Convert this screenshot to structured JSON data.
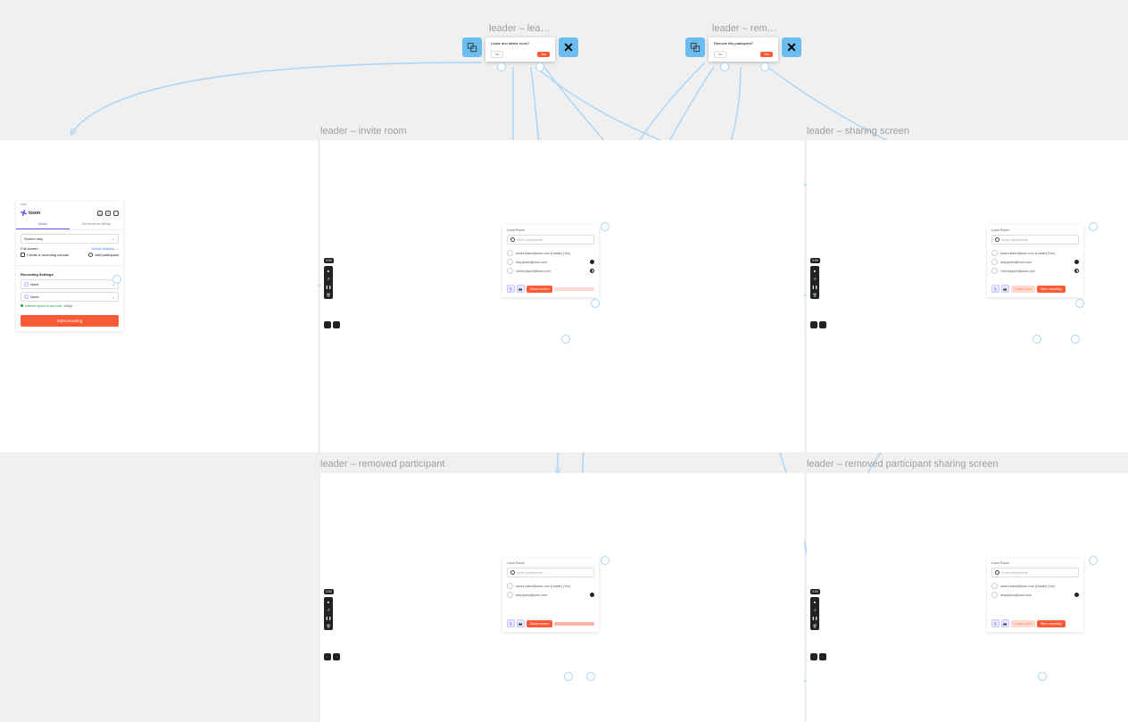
{
  "popups": {
    "leave": {
      "label": "leader – lea…",
      "title": "Leave and delete room?",
      "no": "No",
      "yes": "Yes"
    },
    "remove": {
      "label": "leader – rem…",
      "title": "Remove this participant?",
      "no": "No",
      "yes": "Yes"
    }
  },
  "labels": {
    "frame2": "leader – invite room",
    "frame3": "leader – sharing screen",
    "frame4": "leader – removed participant",
    "frame5": "leader – removed participant sharing screen"
  },
  "loom": {
    "brand": "loom",
    "win_title": "Loom",
    "tab_video": "Video",
    "tab_shot": "Screenshot (Beta)",
    "src": "Screen only",
    "scope": "Full screen",
    "select_desktop": "Select desktop",
    "canvas": "Create a recording canvas",
    "add_participant": "Add participant",
    "settings_head": "Recording Settings",
    "opt_none": "None",
    "hint": "Internet speed is very fast",
    "resolution": "1080p",
    "start": "Start recording"
  },
  "timer": "0:00",
  "room": {
    "title": "Loom Room",
    "invite_placeholder": "Invite participants",
    "p1": "lauren.ibsen@loom.com (Leader) (You)",
    "p2": "larry.ipsen@loom.com",
    "p3": "OremLipsum@loom.com",
    "share": "Share screen",
    "leave": "Leave room",
    "start": "Start recording"
  }
}
